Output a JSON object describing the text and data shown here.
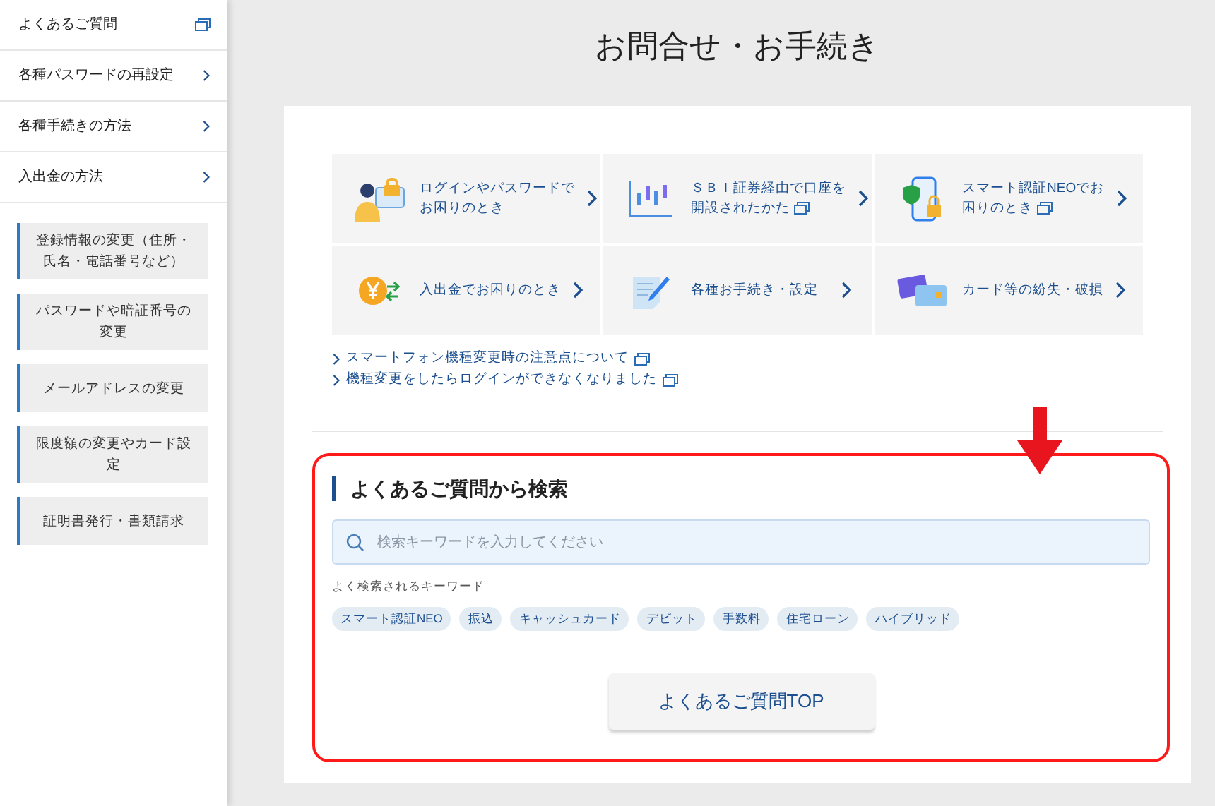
{
  "sidebar": {
    "items": [
      {
        "label": "よくあるご質問",
        "kind": "external"
      },
      {
        "label": "各種パスワードの再設定",
        "kind": "chevron"
      },
      {
        "label": "各種手続きの方法",
        "kind": "chevron"
      },
      {
        "label": "入出金の方法",
        "kind": "chevron"
      }
    ],
    "sub_items": [
      "登録情報の変更（住所・氏名・電話番号など）",
      "パスワードや暗証番号の変更",
      "メールアドレスの変更",
      "限度額の変更やカード設定",
      "証明書発行・書類請求"
    ]
  },
  "page_title": "お問合せ・お手続き",
  "tiles": [
    {
      "kind": "login",
      "lines": [
        "ログインやパスワードで",
        "お困りのとき"
      ],
      "external": false
    },
    {
      "kind": "chart",
      "lines": [
        "ＳＢＩ証券経由で口座を",
        "開設されたかた"
      ],
      "external": true
    },
    {
      "kind": "phone",
      "lines": [
        "スマート認証NEOでお",
        "困りのとき"
      ],
      "external": true
    },
    {
      "kind": "yen",
      "lines": [
        "入出金でお困りのとき"
      ],
      "external": false
    },
    {
      "kind": "form",
      "lines": [
        "各種お手続き・設定"
      ],
      "external": false
    },
    {
      "kind": "card",
      "lines": [
        "カード等の紛失・破損"
      ],
      "external": false
    }
  ],
  "links": [
    {
      "label": "スマートフォン機種変更時の注意点について",
      "external": true
    },
    {
      "label": "機種変更をしたらログインができなくなりました",
      "external": true
    }
  ],
  "faq_search": {
    "heading": "よくあるご質問から検索",
    "placeholder": "検索キーワードを入力してください",
    "keywords_label": "よく検索されるキーワード",
    "keywords": [
      "スマート認証NEO",
      "振込",
      "キャッシュカード",
      "デビット",
      "手数料",
      "住宅ローン",
      "ハイブリッド"
    ],
    "top_button": "よくあるご質問TOP"
  }
}
